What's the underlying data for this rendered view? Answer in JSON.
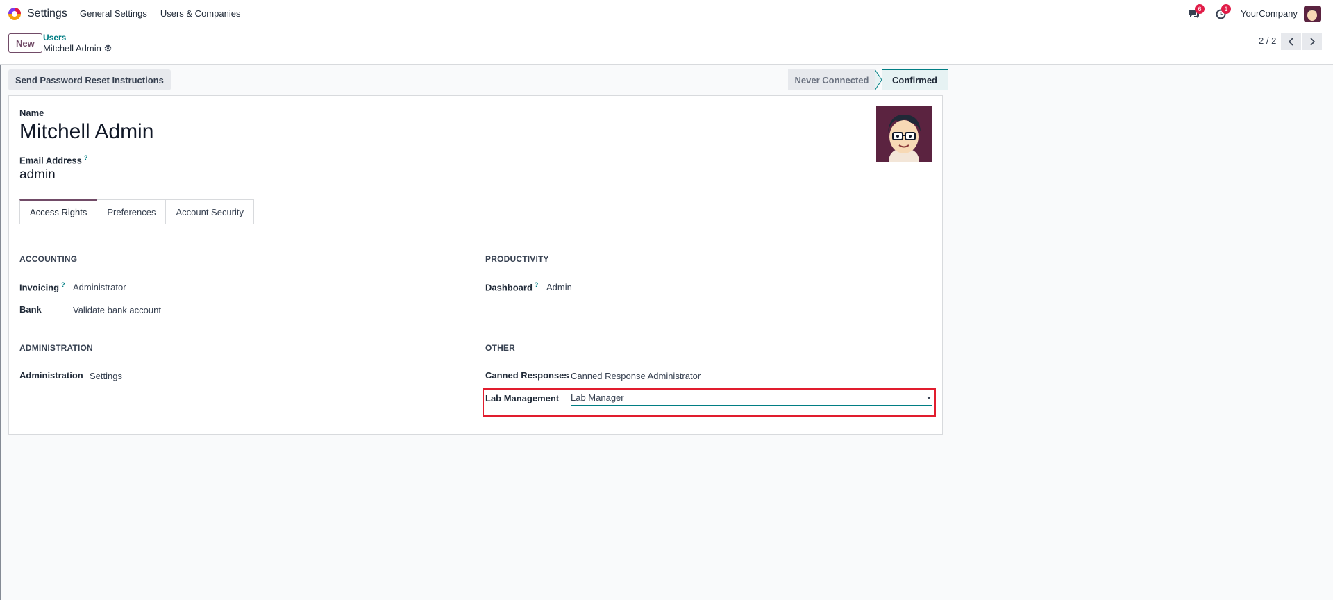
{
  "navbar": {
    "app_name": "Settings",
    "menu": [
      "General Settings",
      "Users & Companies"
    ],
    "messages_badge": "6",
    "activities_badge": "1",
    "company": "YourCompany"
  },
  "control_panel": {
    "new_label": "New",
    "breadcrumb_parent": "Users",
    "breadcrumb_current": "Mitchell Admin",
    "pager": "2 / 2"
  },
  "status": {
    "reset_button": "Send Password Reset Instructions",
    "steps": [
      "Never Connected",
      "Confirmed"
    ],
    "active_step": "Confirmed"
  },
  "form": {
    "name_label": "Name",
    "name_value": "Mitchell Admin",
    "email_label": "Email Address",
    "email_value": "admin",
    "help_marker": "?",
    "tabs": [
      "Access Rights",
      "Preferences",
      "Account Security"
    ],
    "active_tab": "Access Rights"
  },
  "groups": {
    "accounting": {
      "title": "ACCOUNTING",
      "fields": [
        {
          "label": "Invoicing",
          "value": "Administrator"
        },
        {
          "label": "Bank",
          "value": "Validate bank account"
        }
      ]
    },
    "productivity": {
      "title": "PRODUCTIVITY",
      "fields": [
        {
          "label": "Dashboard",
          "value": "Admin"
        }
      ]
    },
    "administration": {
      "title": "ADMINISTRATION",
      "fields": [
        {
          "label": "Administration",
          "value": "Settings"
        }
      ]
    },
    "other": {
      "title": "OTHER",
      "fields": [
        {
          "label": "Canned Responses",
          "value": "Canned Response Administrator"
        },
        {
          "label": "Lab Management",
          "value": "Lab Manager"
        }
      ]
    }
  },
  "colors": {
    "brand": "#714b67",
    "accent": "#017e84",
    "badge": "#e11d48",
    "highlight": "#e11d2e"
  }
}
